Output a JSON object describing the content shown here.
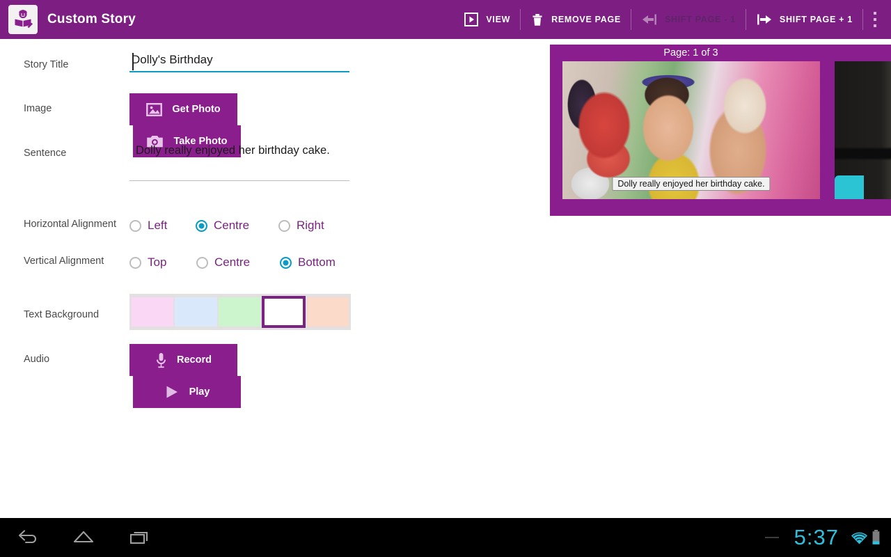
{
  "app": {
    "title": "Custom Story",
    "logo_icon": "reading-girl-icon"
  },
  "toolbar": {
    "actions": [
      {
        "label": "VIEW",
        "icon": "play-box-icon",
        "enabled": true
      },
      {
        "label": "REMOVE PAGE",
        "icon": "trash-icon",
        "enabled": true
      },
      {
        "label": "SHIFT PAGE - 1",
        "icon": "arrow-left-bar-icon",
        "enabled": false
      },
      {
        "label": "SHIFT PAGE + 1",
        "icon": "arrow-right-bar-icon",
        "enabled": true
      }
    ],
    "overflow_icon": "more-vertical-icon"
  },
  "form": {
    "story_title": {
      "label": "Story Title",
      "value": "Dolly's Birthday",
      "placeholder": "Story Title",
      "underline_color": "#0A9CC4"
    },
    "image": {
      "label": "Image",
      "get_photo_label": "Get Photo",
      "get_photo_icon": "picture-icon",
      "take_photo_label": "Take Photo",
      "take_photo_icon": "camera-icon"
    },
    "sentence": {
      "label": "Sentence",
      "value": "Dolly really enjoyed her birthday cake.",
      "placeholder": "Sentence"
    },
    "horizontal_alignment": {
      "label": "Horizontal Alignment",
      "options": [
        "Left",
        "Centre",
        "Right"
      ],
      "selected": "Centre"
    },
    "vertical_alignment": {
      "label": "Vertical Alignment",
      "options": [
        "Top",
        "Centre",
        "Bottom"
      ],
      "selected": "Bottom"
    },
    "text_background": {
      "label": "Text Background",
      "swatches": [
        "#FBD7F6",
        "#D9E8FB",
        "#CCF5CE",
        "#FFFFFF",
        "#FBDACA"
      ],
      "selected_index": 3,
      "selection_color": "#7B2382"
    },
    "audio": {
      "label": "Audio",
      "record_label": "Record",
      "record_icon": "microphone-icon",
      "play_label": "Play",
      "play_icon": "play-triangle-icon"
    }
  },
  "preview": {
    "page_label": "Page: 1 of 3",
    "pages": [
      {
        "caption": "Dolly really enjoyed her birthday cake."
      },
      {
        "caption": ""
      }
    ]
  },
  "system_bar": {
    "back_icon": "back-arrow-icon",
    "home_icon": "home-icon",
    "recents_icon": "recents-icon",
    "time": "5:37",
    "wifi_icon": "wifi-icon",
    "battery_icon": "battery-icon",
    "clock_color": "#2FBEDC"
  },
  "theme": {
    "appbar_purple": "#7D1F82",
    "button_purple": "#8A1E8C",
    "accent_teal": "#0A9CC4",
    "radio_label_purple": "#7B2382"
  }
}
